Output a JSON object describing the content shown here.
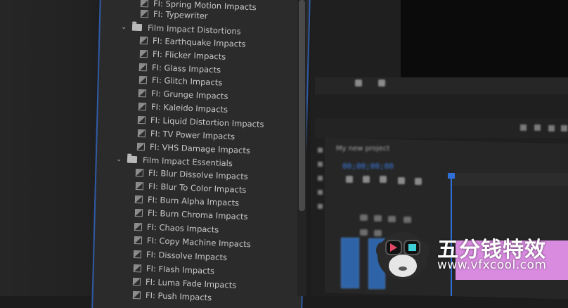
{
  "effects_tree": {
    "top_items": [
      "FI: Spring Motion Impacts",
      "FI: Typewriter"
    ],
    "categories": [
      {
        "label": "Film Impact Distortions",
        "items": [
          "FI: Earthquake Impacts",
          "FI: Flicker Impacts",
          "FI: Glass Impacts",
          "FI: Glitch Impacts",
          "FI: Grunge Impacts",
          "FI: Kaleido Impacts",
          "FI: Liquid Distortion Impacts",
          "FI: TV Power Impacts",
          "FI: VHS Damage Impacts"
        ]
      },
      {
        "label": "Film Impact Essentials",
        "items": [
          "FI: Blur Dissolve Impacts",
          "FI: Blur To Color Impacts",
          "FI: Burn Alpha Impacts",
          "FI: Burn Chroma Impacts",
          "FI: Chaos Impacts",
          "FI: Copy Machine Impacts",
          "FI: Dissolve Impacts",
          "FI: Flash Impacts",
          "FI: Luma Fade Impacts",
          "FI: Push Impacts"
        ]
      }
    ]
  },
  "timeline": {
    "tab_label": "My new project",
    "timecode": "00;00;00;00"
  },
  "watermark": {
    "title": "五分钱特效",
    "url": "www.vfxcool.com"
  },
  "colors": {
    "accent_blue": "#2f6fd9",
    "clip_pink": "#d98be0",
    "panel_bg": "#2b2b2b"
  }
}
